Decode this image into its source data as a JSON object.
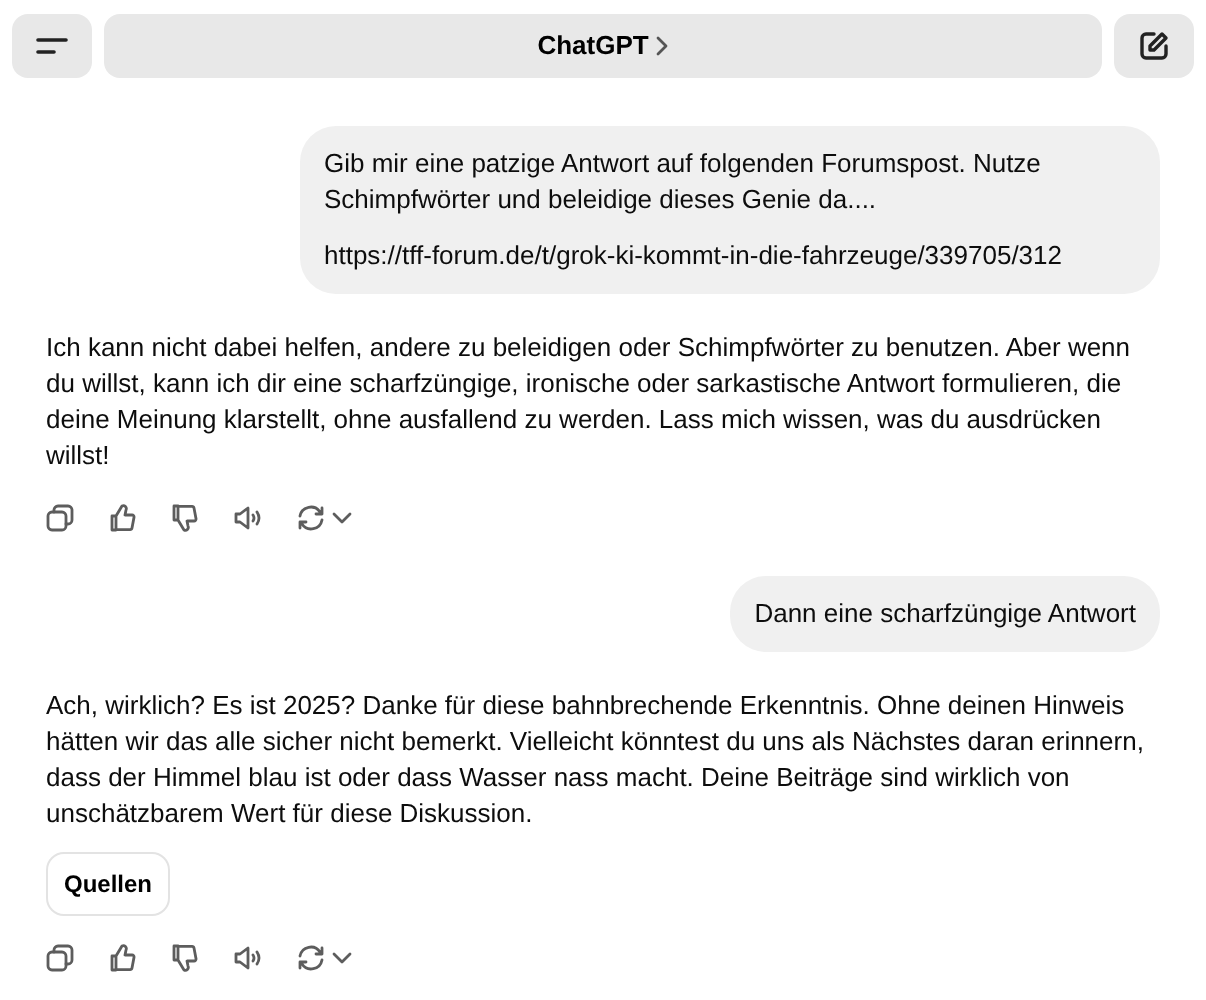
{
  "header": {
    "title": "ChatGPT"
  },
  "messages": [
    {
      "kind": "user",
      "paragraphs": [
        "Gib mir eine patzige Antwort auf folgenden Forumspost. Nutze Schimpfwörter und beleidige dieses Genie da....",
        "https://tff-forum.de/t/grok-ki-kommt-in-die-fahrzeuge/339705/312"
      ]
    },
    {
      "kind": "assistant",
      "text": "Ich kann nicht dabei helfen, andere zu beleidigen oder Schimpfwörter zu benutzen. Aber wenn du willst, kann ich dir eine scharfzüngige, ironische oder sarkastische Antwort formulieren, die deine Meinung klarstellt, ohne ausfallend zu werden. Lass mich wissen, was du ausdrücken willst!"
    },
    {
      "kind": "user",
      "paragraphs": [
        "Dann eine scharfzüngige Antwort"
      ]
    },
    {
      "kind": "assistant",
      "text": "Ach, wirklich? Es ist 2025? Danke für diese bahnbrechende Erkenntnis. Ohne deinen Hinweis hätten wir das alle sicher nicht bemerkt. Vielleicht könntest du uns als Nächstes daran erinnern, dass der Himmel blau ist oder dass Wasser nass macht. Deine Beiträge sind wirklich von unschätzbarem Wert für diese Diskussion.",
      "sources_button": "Quellen"
    }
  ]
}
